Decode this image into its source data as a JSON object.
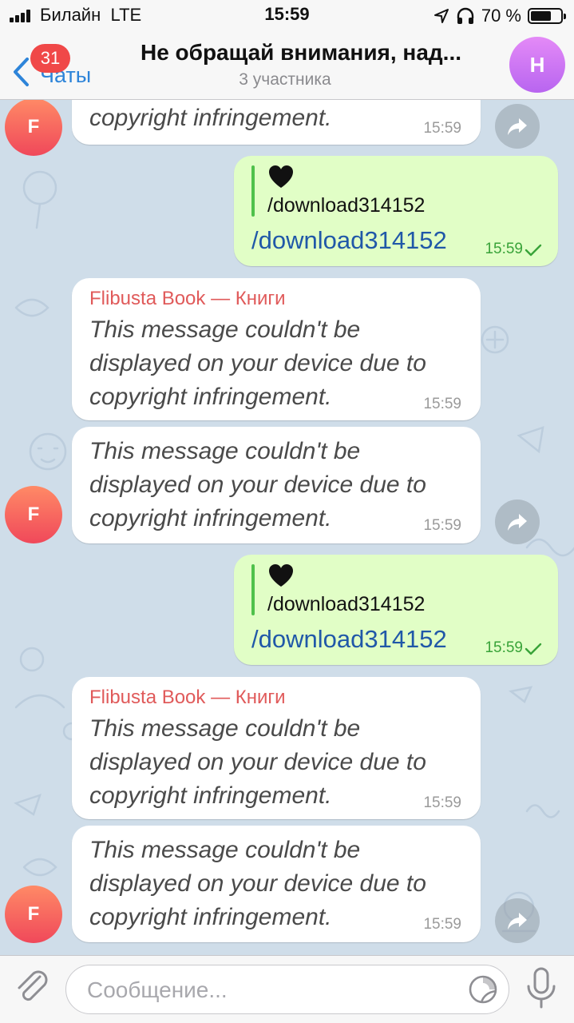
{
  "status_bar": {
    "carrier": "Билайн",
    "network": "LTE",
    "time": "15:59",
    "battery_percent": "70 %",
    "battery_level": 0.7
  },
  "header": {
    "back_label": "Чаты",
    "unread_badge": "31",
    "title": "Не обращай внимания, над...",
    "subtitle": "3 участника",
    "avatar_letter": "Н",
    "avatar_color": "#d27bf5"
  },
  "messages": [
    {
      "type": "incoming",
      "text_lines": [
        "copyright infringement."
      ],
      "time": "15:59",
      "avatar": "F"
    },
    {
      "type": "outgoing",
      "reply_emoji": "black-heart-icon",
      "reply_text": "/download314152",
      "text": "/download314152",
      "time": "15:59"
    },
    {
      "type": "incoming",
      "sender": "Flibusta Book — Книги",
      "text_lines": [
        "This message couldn't be",
        "displayed on your device due to",
        "copyright infringement."
      ],
      "time": "15:59"
    },
    {
      "type": "incoming",
      "text_lines": [
        "This message couldn't be",
        "displayed on your device due to",
        "copyright infringement."
      ],
      "time": "15:59",
      "avatar": "F"
    },
    {
      "type": "outgoing",
      "reply_emoji": "black-heart-icon",
      "reply_text": "/download314152",
      "text": "/download314152",
      "time": "15:59"
    },
    {
      "type": "incoming",
      "sender": "Flibusta Book — Книги",
      "text_lines": [
        "This message couldn't be",
        "displayed on your device due to",
        "copyright infringement."
      ],
      "time": "15:59"
    },
    {
      "type": "incoming",
      "text_lines": [
        "This message couldn't be",
        "displayed on your device due to",
        "copyright infringement."
      ],
      "time": "15:59",
      "avatar": "F"
    }
  ],
  "input": {
    "placeholder": "Сообщение..."
  },
  "colors": {
    "accent": "#2d84d9",
    "badge": "#f04848",
    "outgoing_bubble": "#e1fec6",
    "incoming_bubble": "#ffffff",
    "sender_name": "#e05a5a",
    "wallpaper": "#cfdde9"
  }
}
